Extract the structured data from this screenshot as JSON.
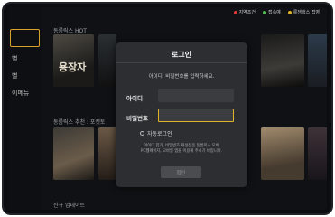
{
  "legend": [
    {
      "label": "지역조건",
      "color": "#e23b3b"
    },
    {
      "label": "접속예",
      "color": "#4fbf4f"
    },
    {
      "label": "룽쟁택스 접영",
      "color": "#e2b325"
    }
  ],
  "sidebar": {
    "items": [
      "별",
      "별",
      "이메뉴"
    ]
  },
  "sections": {
    "hot_title": "동름릭스 HOT",
    "recommend_title": "동름릭스 추천 : 포켓토",
    "new_title": "신규 업데이트"
  },
  "posters": {
    "p1_text": "용장자"
  },
  "dialog": {
    "title": "로그인",
    "message": "아이디, 비밀번호를 입력하세요.",
    "id_label": "아이디",
    "password_label": "비밀번호",
    "id_value": "",
    "password_value": "",
    "auto_login_label": "자동로그인",
    "help_line1": "아이디 찾기, 비밀번호 재설정은 동름릭스 모바",
    "help_line2": "PC웹페이지, 모바일 앱을 이용해 주시기 바랍니다.",
    "confirm_label": "확인"
  }
}
